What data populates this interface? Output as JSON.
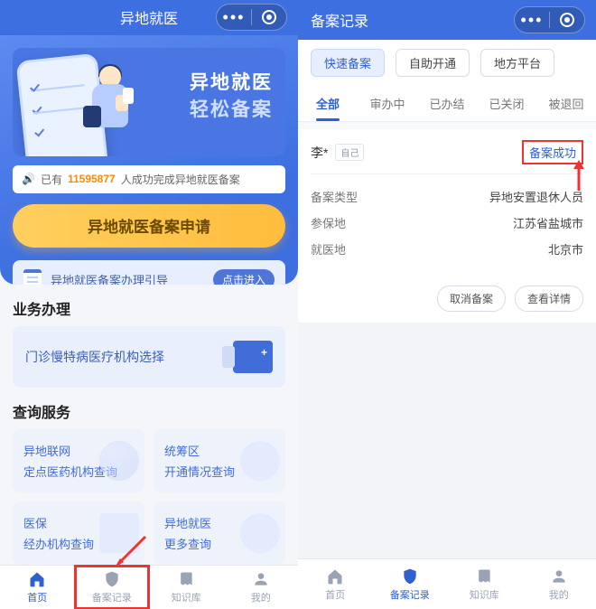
{
  "left": {
    "header_title": "异地就医",
    "hero_line1": "异地就医",
    "hero_line2": "轻松备案",
    "stat_prefix": "已有",
    "stat_number": "11595877",
    "stat_suffix": "人成功完成异地就医备案",
    "apply_label": "异地就医备案申请",
    "guide_label": "异地就医备案办理引导",
    "guide_pill": "点击进入",
    "section_biz": "业务办理",
    "card1_label": "门诊慢特病医疗机构选择",
    "section_query": "查询服务",
    "q1_l1": "异地联网",
    "q1_l2": "定点医药机构查询",
    "q2_l1": "统筹区",
    "q2_l2": "开通情况查询",
    "q3_l1": "医保",
    "q3_l2": "经办机构查询",
    "q4_l1": "异地就医",
    "q4_l2": "更多查询",
    "tabs": {
      "home": "首页",
      "record": "备案记录",
      "knowledge": "知识库",
      "mine": "我的"
    }
  },
  "right": {
    "header_title": "备案记录",
    "pills": {
      "quick": "快速备案",
      "self": "自助开通",
      "local": "地方平台"
    },
    "tabs": {
      "all": "全部",
      "processing": "审办中",
      "done": "已办结",
      "closed": "已关闭",
      "rejected": "被退回"
    },
    "record": {
      "name": "李*",
      "self_tag": "自己",
      "status": "备案成功",
      "rows": [
        {
          "k": "备案类型",
          "v": "异地安置退休人员"
        },
        {
          "k": "参保地",
          "v": "江苏省盐城市"
        },
        {
          "k": "就医地",
          "v": "北京市"
        }
      ],
      "cancel": "取消备案",
      "detail": "查看详情"
    },
    "tabs_bar": {
      "home": "首页",
      "record": "备案记录",
      "knowledge": "知识库",
      "mine": "我的"
    }
  }
}
